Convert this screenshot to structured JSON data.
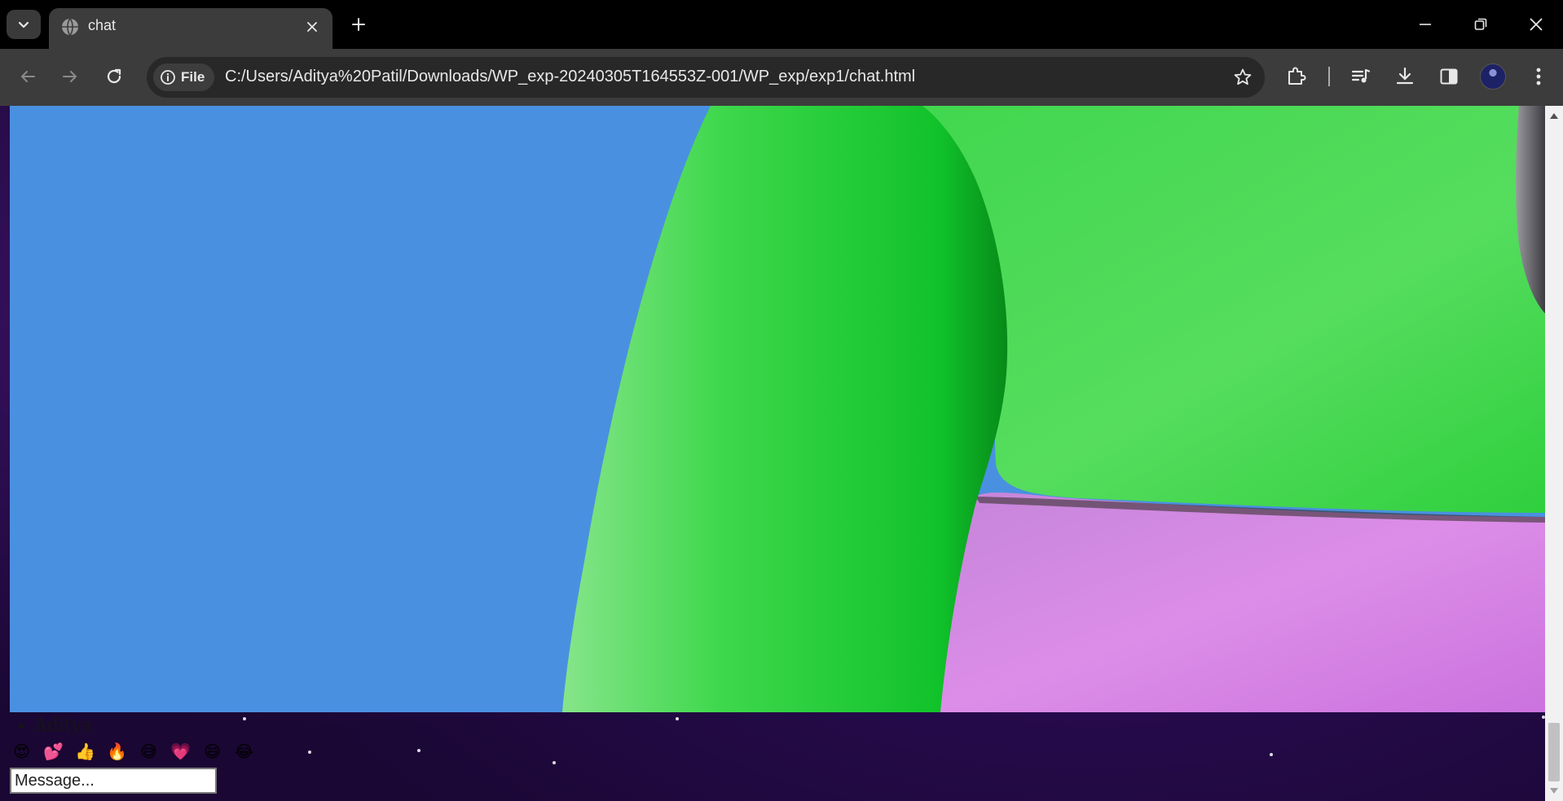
{
  "browser": {
    "tab": {
      "title": "chat"
    },
    "address": {
      "chip_label": "File",
      "url": "C:/Users/Aditya%20Patil/Downloads/WP_exp-20240305T164553Z-001/WP_exp/exp1/chat.html"
    },
    "icons": {
      "tab_search": "chevron-down-icon",
      "favicon": "globe-icon",
      "tab_close": "close-icon",
      "new_tab": "plus-icon",
      "minimize": "minimize-icon",
      "restore": "restore-icon",
      "window_close": "close-icon",
      "back": "back-arrow-icon",
      "forward": "forward-arrow-icon",
      "reload": "reload-icon",
      "site_info": "info-icon",
      "bookmark": "star-icon",
      "extensions": "puzzle-icon",
      "media": "media-queue-icon",
      "downloads": "download-icon",
      "side_panel": "side-panel-icon",
      "profile": "avatar",
      "menu": "kebab-menu-icon"
    }
  },
  "page": {
    "hero_image": {
      "colors": {
        "background": "#4a90e0",
        "green": "#3cd64f",
        "purple": "#d07fe0",
        "metal": "#6a6a70"
      }
    },
    "chat": {
      "users": [
        "Aditya"
      ],
      "emojis": [
        "😍",
        "💕",
        "👍",
        "🔥",
        "😅",
        "💗",
        "😄",
        "😂"
      ],
      "message_placeholder": "Message..."
    }
  }
}
